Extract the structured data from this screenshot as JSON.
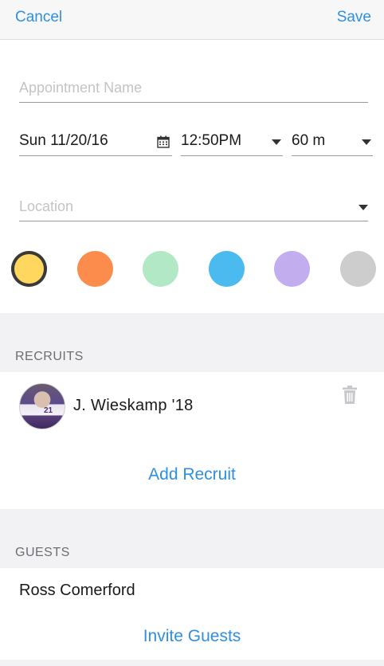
{
  "nav": {
    "cancel_label": "Cancel",
    "save_label": "Save"
  },
  "form": {
    "appointment_name_placeholder": "Appointment Name",
    "date_value": "Sun 11/20/16",
    "time_value": "12:50PM",
    "duration_value": "60 m",
    "location_placeholder": "Location"
  },
  "colors": {
    "options": [
      "#ffd75e",
      "#fb8c4c",
      "#b2e8c6",
      "#4bbaee",
      "#c2adee",
      "#cdcdcd"
    ],
    "selected_index": 0
  },
  "recruits": {
    "section_title": "RECRUITS",
    "items": [
      {
        "name": "J. Wieskamp '18",
        "avatar_number": "21"
      }
    ],
    "add_label": "Add Recruit"
  },
  "guests": {
    "section_title": "GUESTS",
    "items": [
      {
        "name": "Ross Comerford"
      }
    ],
    "invite_label": "Invite Guests"
  }
}
